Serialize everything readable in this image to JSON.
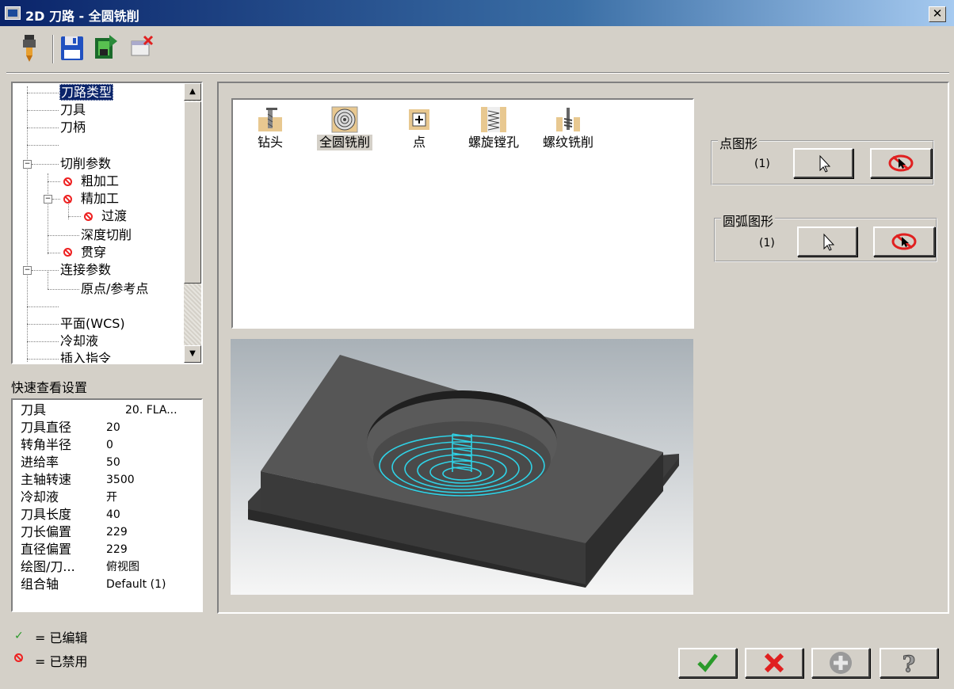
{
  "window": {
    "title": "2D 刀路 - 全圆铣削",
    "close_label": "✕"
  },
  "toolbar": {
    "items": [
      "tool-icon",
      "save-icon",
      "export-icon",
      "delete-icon"
    ]
  },
  "tree": {
    "items": [
      "刀路类型",
      "刀具",
      "刀柄",
      "切削参数",
      "粗加工",
      "精加工",
      "过渡",
      "深度切削",
      "贯穿",
      "连接参数",
      "原点/参考点",
      "平面(WCS)",
      "冷却液",
      "插入指令"
    ],
    "selected": "刀路类型"
  },
  "quick_view": {
    "title": "快速查看设置",
    "rows": [
      {
        "label": "刀具",
        "value": "20. FLA..."
      },
      {
        "label": "刀具直径",
        "value": "20"
      },
      {
        "label": "转角半径",
        "value": "0"
      },
      {
        "label": "进给率",
        "value": "50"
      },
      {
        "label": "主轴转速",
        "value": "3500"
      },
      {
        "label": "冷却液",
        "value": "开"
      },
      {
        "label": "刀具长度",
        "value": "40"
      },
      {
        "label": "刀长偏置",
        "value": "229"
      },
      {
        "label": "直径偏置",
        "value": "229"
      },
      {
        "label": "绘图/刀...",
        "value": "俯视图"
      },
      {
        "label": "组合轴",
        "value": "Default (1)"
      }
    ]
  },
  "legend": {
    "edited": "= 已编辑",
    "disabled": "= 已禁用"
  },
  "toolpath_types": [
    "钻头",
    "全圆铣削",
    "点",
    "螺旋镗孔",
    "螺纹铣削"
  ],
  "selected_type": "全圆铣削",
  "point_group": {
    "title": "点图形",
    "count": "(1)"
  },
  "arc_group": {
    "title": "圆弧图形",
    "count": "(1)"
  },
  "colors": {
    "accent": "#0a246a",
    "toolpath": "#2fd2e6",
    "ok_green": "#2a9a2a",
    "cancel_red": "#e02020"
  }
}
